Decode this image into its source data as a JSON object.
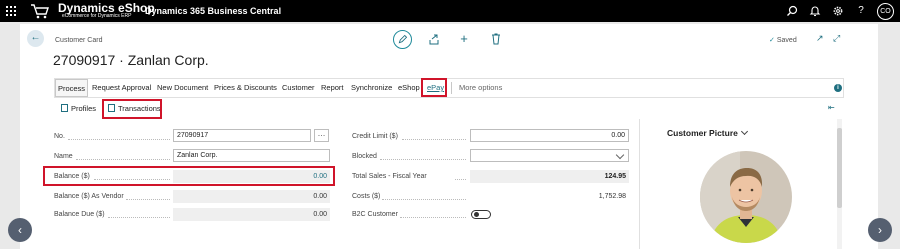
{
  "topbar": {
    "logo_title": "Dynamics eShop",
    "logo_subtitle": "eCommerce for Dynamics ERP",
    "product_name": "Dynamics 365 Business Central",
    "user_initials": "CO",
    "icons": [
      "waffle-icon",
      "cart-logo-icon",
      "search-icon",
      "bell-icon",
      "settings-icon",
      "help-icon",
      "avatar"
    ]
  },
  "page": {
    "breadcrumb": "Customer Card",
    "title": "27090917 · Zanlan Corp.",
    "saved_label": "Saved",
    "actions": [
      "edit-icon",
      "share-icon",
      "new-icon",
      "delete-icon"
    ]
  },
  "action_bar": {
    "items": [
      "Process",
      "Request Approval",
      "New Document",
      "Prices & Discounts",
      "Customer",
      "Report",
      "Synchronize",
      "eShop",
      "ePay"
    ],
    "more": "More options"
  },
  "sub_bar": {
    "profiles": "Profiles",
    "transactions": "Transactions"
  },
  "fields_left": {
    "no_label": "No.",
    "no_value": "27090917",
    "name_label": "Name",
    "name_value": "Zanlan Corp.",
    "balance_label": "Balance ($)",
    "balance_value": "0.00",
    "balance_vendor_label": "Balance ($) As Vendor",
    "balance_vendor_value": "0.00",
    "balance_due_label": "Balance Due ($)",
    "balance_due_value": "0.00"
  },
  "fields_right": {
    "credit_limit_label": "Credit Limit ($)",
    "credit_limit_value": "0.00",
    "blocked_label": "Blocked",
    "blocked_value": "",
    "total_sales_label": "Total Sales - Fiscal Year",
    "total_sales_value": "124.95",
    "costs_label": "Costs ($)",
    "costs_value": "1,752.98",
    "b2c_label": "B2C Customer",
    "b2c_on": false
  },
  "factbox": {
    "title": "Customer Picture"
  },
  "colors": {
    "accent": "#1f6f80",
    "highlight": "#d0142a",
    "topbar": "#000000"
  }
}
